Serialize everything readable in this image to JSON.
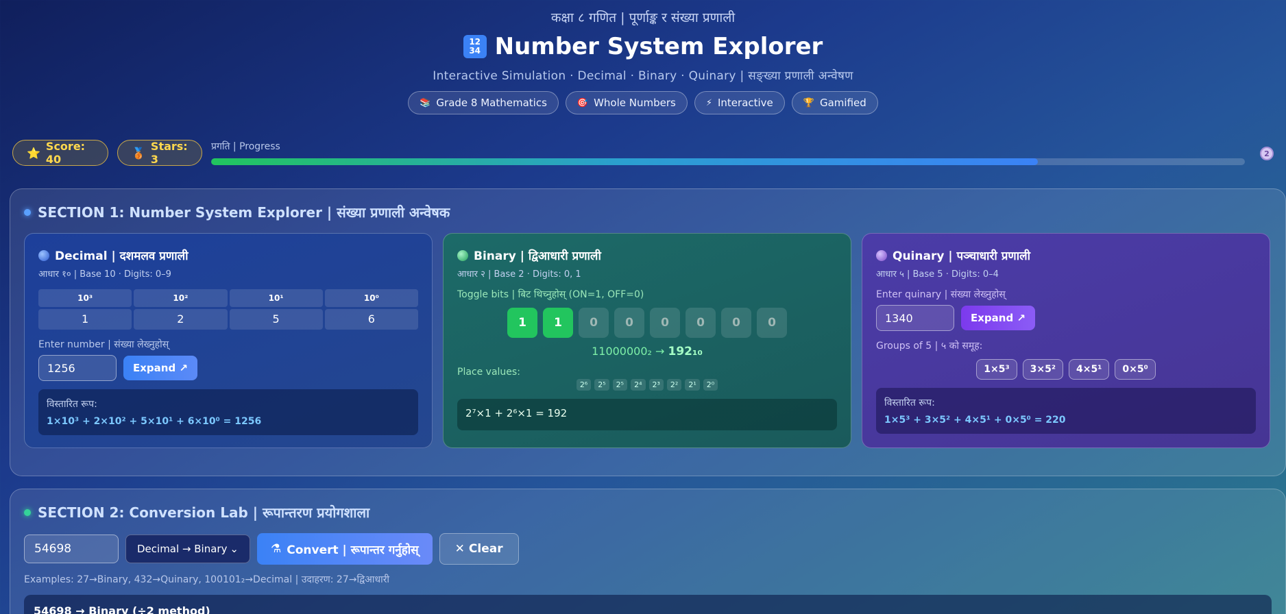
{
  "header": {
    "top_label": "कक्षा ८ गणित | पूर्णाङ्क र संख्या प्रणाली",
    "title_icon": "1234-icon",
    "title": "Number System Explorer",
    "subtitle": "Interactive Simulation · Decimal · Binary · Quinary | सङ्ख्या प्रणाली अन्वेषण",
    "tags": [
      {
        "icon": "books-icon",
        "label": "Grade 8 Mathematics"
      },
      {
        "icon": "target-icon",
        "label": "Whole Numbers"
      },
      {
        "icon": "lightning-icon",
        "label": "Interactive"
      },
      {
        "icon": "trophy-icon",
        "label": "Gamified"
      }
    ]
  },
  "stats": {
    "score_label": "Score: 40",
    "stars_label": "Stars: 3",
    "progress_label": "प्रगति | Progress",
    "progress_fraction": 0.8,
    "medal": "2"
  },
  "section1": {
    "title": "SECTION 1: Number System Explorer | संख्या प्रणाली अन्वेषक",
    "decimal": {
      "title": "Decimal | दशमलव प्रणाली",
      "sub": "आधार १० | Base 10 · Digits: 0–9",
      "place_heads": [
        "10³",
        "10²",
        "10¹",
        "10⁰"
      ],
      "digits": [
        "1",
        "2",
        "5",
        "6"
      ],
      "input_label": "Enter number | संख्या लेख्नुहोस्",
      "input_value": "1256",
      "expand_label": "Expand ↗",
      "result_label": "विस्तारित रूप:",
      "result_expr": "1×10³ + 2×10² + 5×10¹ + 6×10⁰ = 1256"
    },
    "binary": {
      "title": "Binary | द्विआधारी प्रणाली",
      "sub": "आधार २ | Base 2 · Digits: 0, 1",
      "toggle_label": "Toggle bits | बिट थिच्नुहोस् (ON=1, OFF=0)",
      "bits": [
        "1",
        "1",
        "0",
        "0",
        "0",
        "0",
        "0",
        "0"
      ],
      "result_binary": "11000000₂ →",
      "result_decimal": "192₁₀",
      "place_label": "Place values:",
      "places": [
        "2⁶",
        "2⁵",
        "2⁵",
        "2⁴",
        "2³",
        "2²",
        "2¹",
        "2⁰"
      ],
      "expr": "2⁷×1 + 2⁶×1 = 192"
    },
    "quinary": {
      "title": "Quinary | पञ्चाधारी प्रणाली",
      "sub": "आधार ५ | Base 5 · Digits: 0–4",
      "input_label": "Enter quinary | संख्या लेख्नुहोस्",
      "input_value": "1340",
      "expand_label": "Expand ↗",
      "groups_label": "Groups of 5 | ५ को समूह:",
      "groups": [
        "1×5³",
        "3×5²",
        "4×5¹",
        "0×5⁰"
      ],
      "result_label": "विस्तारित रूप:",
      "result_expr": "1×5³ + 3×5² + 4×5¹ + 0×5⁰ = 220"
    }
  },
  "section2": {
    "title": "SECTION 2: Conversion Lab | रूपान्तरण प्रयोगशाला",
    "input_value": "54698",
    "select_value": "Decimal → Binary",
    "convert_label": "Convert | रूपान्तर गर्नुहोस्",
    "clear_label": "Clear",
    "examples": "Examples: 27→Binary, 432→Quinary, 100101₂→Decimal | उदाहरण: 27→द्विआधारी",
    "result_heading": "54698 → Binary (÷2 method)"
  }
}
